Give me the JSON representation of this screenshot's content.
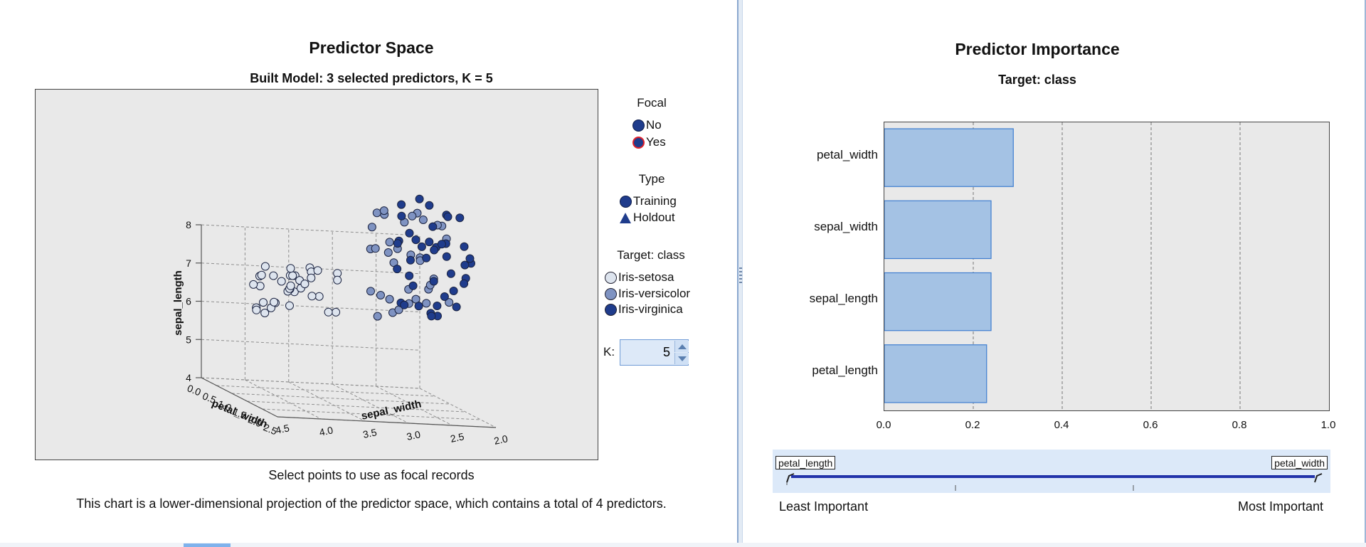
{
  "predictor_space": {
    "title": "Predictor Space",
    "subtitle": "Built Model: 3 selected predictors, K = 5",
    "axes": {
      "z_label": "sepal_length",
      "x_label": "petal_width",
      "y_label": "sepal_width",
      "z_ticks": [
        "4",
        "5",
        "6",
        "7",
        "8"
      ],
      "x_ticks": [
        "0.0",
        "0.5",
        "1.0",
        "1.5",
        "2.0",
        "2.5"
      ],
      "y_ticks": [
        "4.5",
        "4.0",
        "3.5",
        "3.0",
        "2.5",
        "2.0"
      ]
    },
    "legend": {
      "focal_title": "Focal",
      "focal_items": [
        {
          "label": "No",
          "fill": "#1f3c8c",
          "stroke": "#0c1c4a"
        },
        {
          "label": "Yes",
          "fill": "#1f3c8c",
          "stroke": "#e0202a"
        }
      ],
      "type_title": "Type",
      "type_items": [
        {
          "label": "Training",
          "icon": "circle-icon"
        },
        {
          "label": "Holdout",
          "icon": "triangle-icon"
        }
      ],
      "target_title": "Target: class",
      "target_items": [
        {
          "label": "Iris-setosa",
          "fill": "#dde4ee"
        },
        {
          "label": "Iris-versicolor",
          "fill": "#7f93c2"
        },
        {
          "label": "Iris-virginica",
          "fill": "#1f3c8c"
        }
      ]
    },
    "k_label": "K:",
    "k_value": "5",
    "select_hint": "Select points to use as focal records",
    "description": "This chart is a lower-dimensional projection of the predictor space, which contains a total of 4 predictors."
  },
  "predictor_importance": {
    "title": "Predictor Importance",
    "subtitle": "Target: class",
    "least_label": "Least Important",
    "most_label": "Most Important",
    "slider_left_tag": "petal_length",
    "slider_right_tag": "petal_width"
  },
  "chart_data": [
    {
      "type": "bar",
      "orientation": "horizontal",
      "title": "Predictor Importance",
      "subtitle": "Target: class",
      "categories": [
        "petal_width",
        "sepal_width",
        "sepal_length",
        "petal_length"
      ],
      "values": [
        0.29,
        0.24,
        0.24,
        0.23
      ],
      "xlim": [
        0.0,
        1.0
      ],
      "x_ticks": [
        "0.0",
        "0.2",
        "0.4",
        "0.6",
        "0.8",
        "1.0"
      ],
      "grid": true,
      "bar_color": "#a4c2e4"
    }
  ],
  "colors": {
    "plot_bg": "#e9e9e9",
    "setosa": "#dde4ee",
    "versicolor": "#7f93c2",
    "virginica": "#1f3c8c",
    "bar_fill": "#a4c2e4",
    "bar_stroke": "#3f7ed0"
  }
}
